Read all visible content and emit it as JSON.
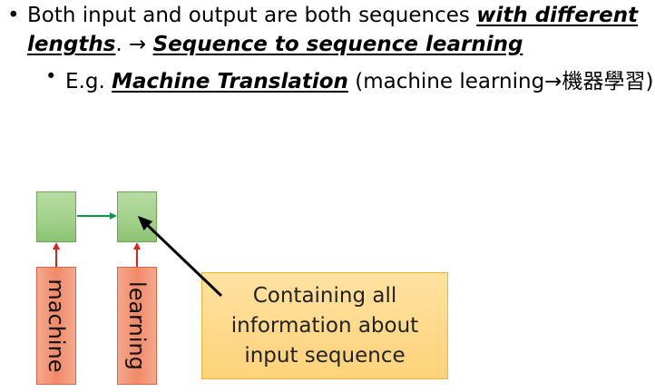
{
  "bullets": {
    "line1_plain": "Both input and output are both sequences ",
    "line1_em": "with different",
    "line2_em1": "lengths",
    "line2_mid": ". → ",
    "line2_em2": "Sequence to sequence learning",
    "sub_prefix": "E.g. ",
    "sub_em": "Machine Translation",
    "sub_suffix": " (machine learning→機器學習)"
  },
  "diagram": {
    "inputs": [
      "machine",
      "learning"
    ],
    "note_lines": [
      "Containing all",
      "information about",
      "input sequence"
    ],
    "colors": {
      "rnn_cell": "#a9d18e",
      "input_box": "#f4a488",
      "note_box": "#ffd98a",
      "arrow_up": "#e0201a",
      "arrow_recurrent": "#00a040",
      "pointer": "#000000"
    }
  }
}
